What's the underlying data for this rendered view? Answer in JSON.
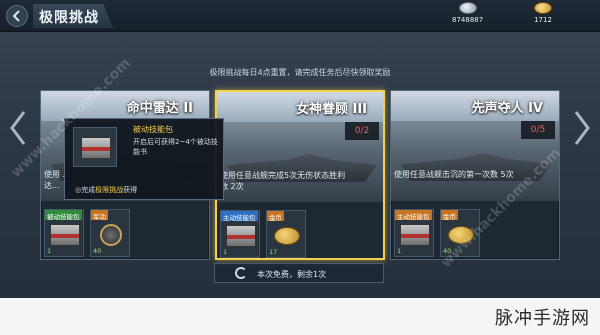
{
  "header": {
    "title": "极限挑战",
    "silver": "8748887",
    "gold": "1712"
  },
  "subtitle": "极限挑战每日4点重置，请完成任务后尽快领取奖励",
  "cards": [
    {
      "name": "命中雷达 II",
      "progress": "",
      "desc": "使用 ...",
      "desc2": "达...",
      "rewards": [
        {
          "tag": "被动技能包",
          "qty": "1",
          "type": "crate"
        },
        {
          "tag": "军功",
          "qty": "40",
          "type": "badge"
        }
      ]
    },
    {
      "name": "女神眷顾 III",
      "progress": "0/2",
      "desc": "使用任意战舰完成5次无伤状态胜利",
      "desc2": "数 2次",
      "rewards": [
        {
          "tag": "主动技能包",
          "qty": "1",
          "type": "crate"
        },
        {
          "tag": "金币",
          "qty": "17",
          "type": "coins"
        }
      ]
    },
    {
      "name": "先声夺人 IV",
      "progress": "0/5",
      "desc": "使用任意战舰击沉的第一次数 5次",
      "desc2": "",
      "rewards": [
        {
          "tag": "主动技能包",
          "qty": "1",
          "type": "crate"
        },
        {
          "tag": "金币",
          "qty": "40",
          "type": "coins"
        }
      ]
    }
  ],
  "tooltip": {
    "title": "被动技能包",
    "desc": "开启后可获得2~4个被动技能书",
    "source_prefix": "◎完成",
    "source_highlight": "极限挑战",
    "source_suffix": "获得"
  },
  "refresh": "本次免费，剩余1次",
  "watermark": "www.hackhome.com",
  "footer_brand": "脉冲手游网",
  "colors": {
    "selected_border": "#f3d050",
    "progress_text": "#e86060",
    "reward_qty": "#9fe07a"
  }
}
